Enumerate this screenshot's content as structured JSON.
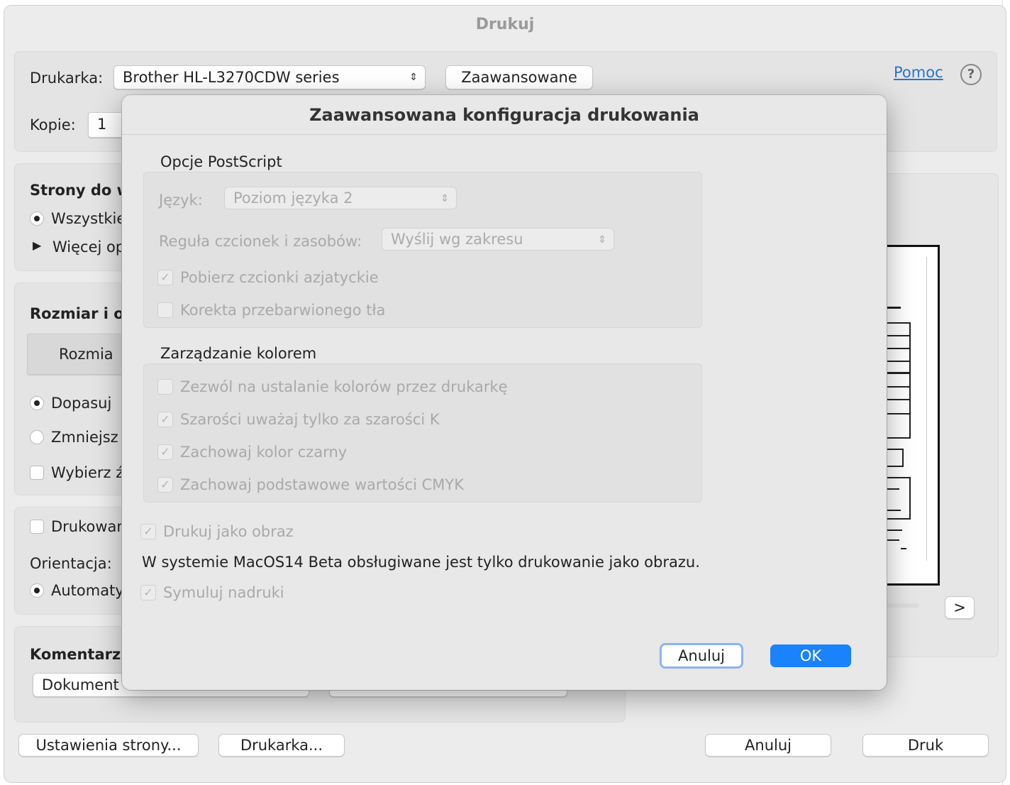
{
  "window": {
    "title": "Drukuj"
  },
  "printer": {
    "label": "Drukarka:",
    "value": "Brother HL-L3270CDW series",
    "advanced_button": "Zaawansowane"
  },
  "help": {
    "link": "Pomoc",
    "icon": "?"
  },
  "copies": {
    "label": "Kopie:",
    "value": "1"
  },
  "pages": {
    "title": "Strony do w",
    "all": "Wszystkie",
    "more": "Więcej op"
  },
  "size": {
    "title": "Rozmiar i ob",
    "tab": "Rozmia",
    "fit": "Dopasuj",
    "shrink": "Zmniejsz",
    "choose": "Wybierz ź"
  },
  "layout": {
    "print_checkbox": "Drukowan",
    "orientation_label": "Orientacja:",
    "orientation_auto": "Automaty"
  },
  "comments": {
    "title": "Komentarze",
    "value": "Dokument"
  },
  "preview": {
    "next_button": ">"
  },
  "footer": {
    "page_setup": "Ustawienia strony...",
    "printer": "Drukarka...",
    "cancel": "Anuluj",
    "print": "Druk"
  },
  "dialog": {
    "title": "Zaawansowana konfiguracja drukowania",
    "postscript": {
      "title": "Opcje PostScript",
      "language_label": "Język:",
      "language_value": "Poziom języka 2",
      "font_rule_label": "Reguła czcionek i zasobów:",
      "font_rule_value": "Wyślij wg zakresu",
      "download_asian": "Pobierz czcionki azjatyckie",
      "bg_correction": "Korekta przebarwionego tła"
    },
    "color": {
      "title": "Zarządzanie kolorem",
      "printer_colors": "Zezwól na ustalanie kolorów przez drukarkę",
      "gray_as_k": "Szarości uważaj tylko za szarości K",
      "keep_black": "Zachowaj kolor czarny",
      "keep_cmyk": "Zachowaj podstawowe wartości CMYK"
    },
    "print_as_image": "Drukuj jako obraz",
    "note": "W systemie MacOS14 Beta obsługiwane jest tylko drukowanie jako obrazu.",
    "simulate_overprint": "Symuluj nadruki",
    "cancel": "Anuluj",
    "ok": "OK"
  }
}
